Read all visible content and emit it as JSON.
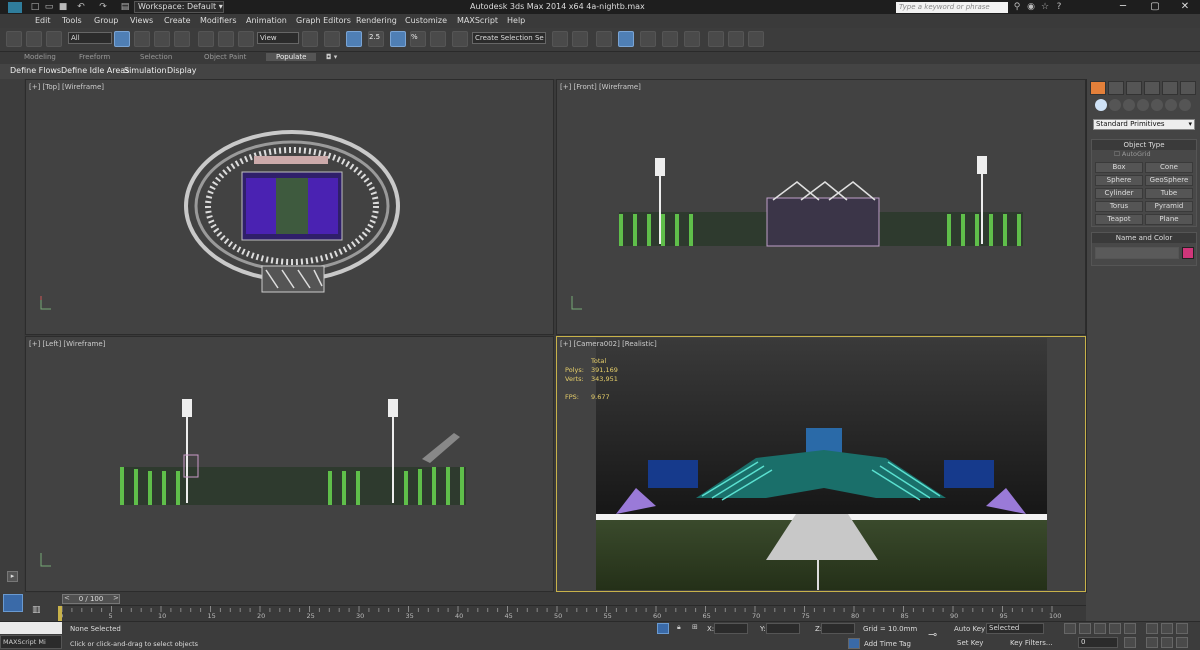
{
  "window": {
    "title": "Autodesk 3ds Max  2014 x64      4a-nightb.max",
    "workspace_label": "Workspace: Default",
    "search_placeholder": "Type a keyword or phrase",
    "controls": {
      "minimize": "─",
      "maximize": "▢",
      "close": "✕"
    }
  },
  "menu": [
    "Edit",
    "Tools",
    "Group",
    "Views",
    "Create",
    "Modifiers",
    "Animation",
    "Graph Editors",
    "Rendering",
    "Customize",
    "MAXScript",
    "Help"
  ],
  "toolbar": {
    "selection_filter": "All",
    "reference_coord": "View",
    "named_selection": "Create Selection Se",
    "snap_value": "2.5",
    "snap_pct": "%"
  },
  "ribbon": {
    "tabs": [
      "Modeling",
      "Freeform",
      "Selection",
      "Object Paint",
      "Populate"
    ],
    "active_tab": "Populate",
    "sub_items": [
      "Define Flows",
      "Define Idle Areas",
      "Simulation",
      "Display"
    ]
  },
  "viewports": {
    "top": "[+] [Top] [Wireframe]",
    "front": "[+] [Front] [Wireframe]",
    "left": "[+] [Left] [Wireframe]",
    "camera": "[+] [Camera002] [Realistic]",
    "stats": {
      "total_label": "Total",
      "polys_label": "Polys:",
      "polys_value": "391,169",
      "verts_label": "Verts:",
      "verts_value": "343,951",
      "fps_label": "FPS:",
      "fps_value": "9.677"
    }
  },
  "command_panel": {
    "primitive_type": "Standard Primitives",
    "object_type_header": "Object Type",
    "autogrid_label": "AutoGrid",
    "buttons": [
      "Box",
      "Cone",
      "Sphere",
      "GeoSphere",
      "Cylinder",
      "Tube",
      "Torus",
      "Pyramid",
      "Teapot",
      "Plane"
    ],
    "name_color_header": "Name and Color",
    "color_swatch": "#d0367a"
  },
  "timeline": {
    "slider_label": "0 / 100",
    "ticks": [
      "0",
      "5",
      "10",
      "15",
      "20",
      "25",
      "30",
      "35",
      "40",
      "45",
      "50",
      "55",
      "60",
      "65",
      "70",
      "75",
      "80",
      "85",
      "90",
      "95",
      "100"
    ]
  },
  "status": {
    "maxscript_label": "MAXScript Mi",
    "selection_status": "None Selected",
    "prompt": "Click or click-and-drag to select objects",
    "x_label": "X:",
    "y_label": "Y:",
    "z_label": "Z:",
    "grid": "Grid = 10.0mm",
    "add_time_tag": "Add Time Tag",
    "auto_key": "Auto Key",
    "set_key": "Set Key",
    "key_mode": "Selected",
    "key_filters": "Key Filters...",
    "frame": "0"
  }
}
